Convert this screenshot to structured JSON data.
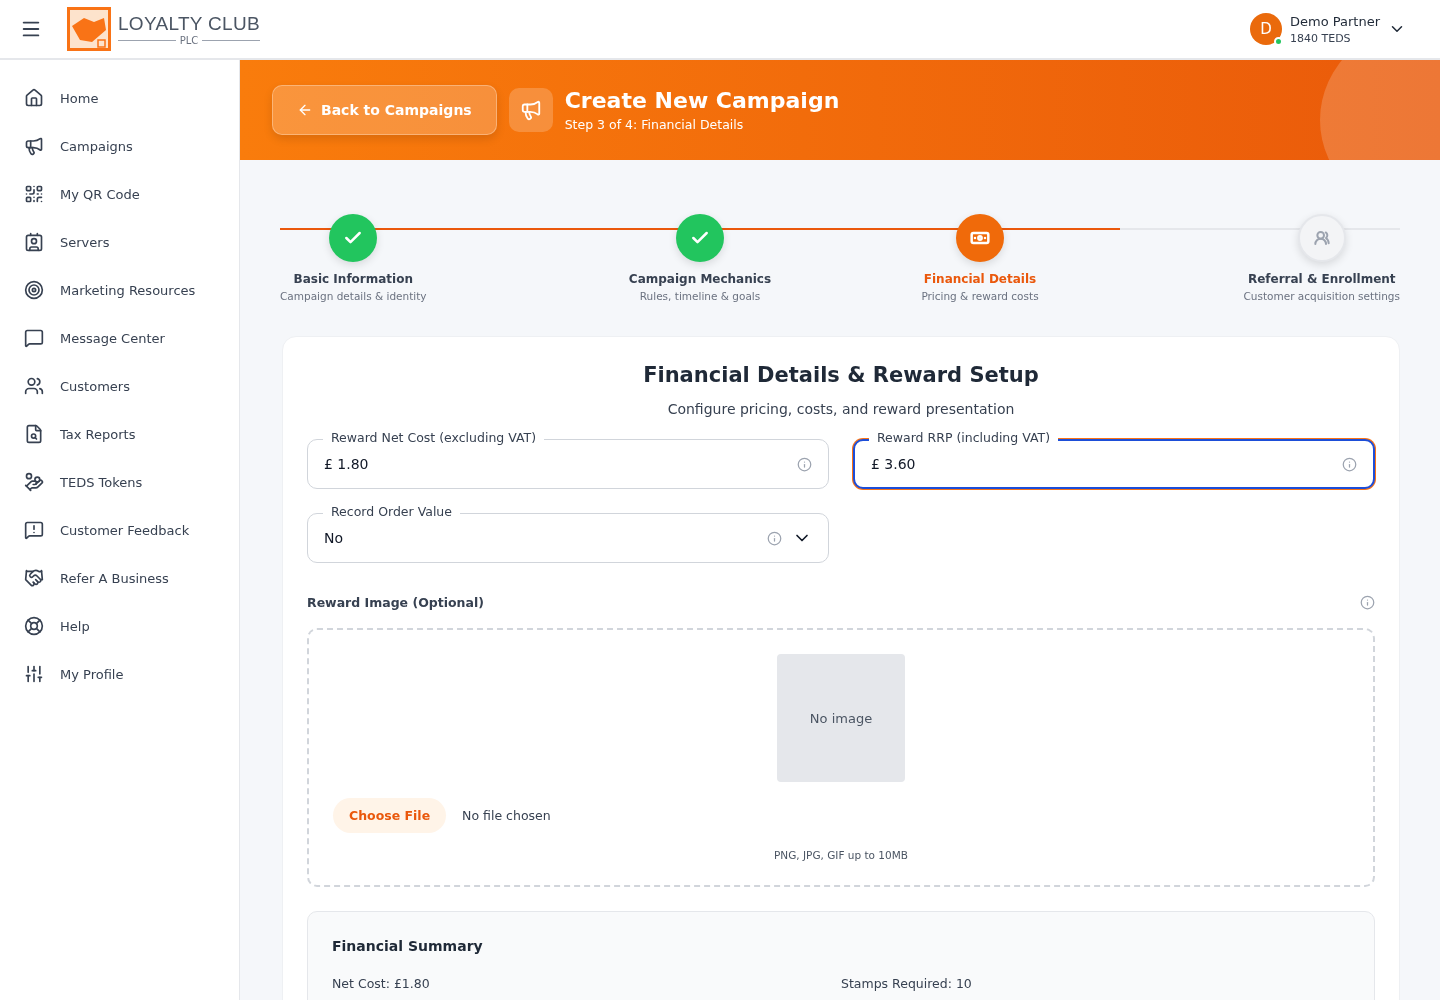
{
  "header": {
    "brand": "LOYALTY CLUB",
    "brand_sub": "PLC",
    "user": {
      "initial": "D",
      "name": "Demo Partner",
      "balance": "1840 TEDS",
      "online": true
    }
  },
  "sidebar": {
    "items": [
      {
        "label": "Home"
      },
      {
        "label": "Campaigns"
      },
      {
        "label": "My QR Code"
      },
      {
        "label": "Servers"
      },
      {
        "label": "Marketing Resources"
      },
      {
        "label": "Message Center"
      },
      {
        "label": "Customers"
      },
      {
        "label": "Tax Reports"
      },
      {
        "label": "TEDS Tokens"
      },
      {
        "label": "Customer Feedback"
      },
      {
        "label": "Refer A Business"
      },
      {
        "label": "Help"
      },
      {
        "label": "My Profile"
      }
    ]
  },
  "banner": {
    "back_button": "Back to Campaigns",
    "title": "Create New Campaign",
    "subtitle": "Step 3 of 4: Financial Details"
  },
  "steps": [
    {
      "title": "Basic Information",
      "subtitle": "Campaign details & identity",
      "completed": true,
      "selected": false
    },
    {
      "title": "Campaign Mechanics",
      "subtitle": "Rules, timeline & goals",
      "completed": true,
      "selected": false
    },
    {
      "title": "Financial Details",
      "subtitle": "Pricing & reward costs",
      "completed": false,
      "selected": true
    },
    {
      "title": "Referral & Enrollment",
      "subtitle": "Customer acquisition settings",
      "completed": false,
      "selected": false
    }
  ],
  "form": {
    "title": "Financial Details & Reward Setup",
    "subtitle": "Configure pricing, costs, and reward presentation",
    "fields": [
      {
        "kind": "text",
        "label": "Reward Net Cost (excluding VAT)",
        "value": "£ 1.80",
        "focused": false
      },
      {
        "kind": "text",
        "label": "Reward RRP (including VAT)",
        "value": "£ 3.60",
        "focused": true
      },
      {
        "kind": "select",
        "label": "Record Order Value",
        "value": "No",
        "focused": false
      }
    ],
    "image": {
      "label": "Reward Image (Optional)",
      "preview": "No image",
      "choose_button": "Choose File",
      "file_status": "No file chosen",
      "hint": "PNG, JPG, GIF up to 10MB"
    },
    "summary": {
      "title": "Financial Summary",
      "items": [
        "Net Cost: £1.80",
        "Stamps Required: 10"
      ]
    }
  }
}
